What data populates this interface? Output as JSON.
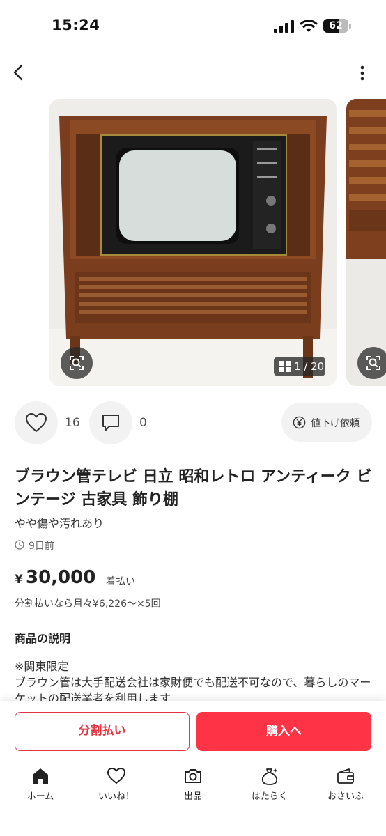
{
  "status_bar": {
    "time": "15:24",
    "battery": "62",
    "battery_fraction": 0.62
  },
  "carousel": {
    "counter": "1 / 20"
  },
  "actions": {
    "likes_count": "16",
    "comments_count": "0",
    "price_down_label": "値下げ依頼"
  },
  "item": {
    "title": "ブラウン管テレビ 日立 昭和レトロ アンティーク ビンテージ 古家具 飾り棚",
    "condition": "やや傷や汚れあり",
    "posted": "9日前",
    "price_symbol": "¥",
    "price": "30,000",
    "shipping": "着払い",
    "installment": "分割払いなら月々¥6,226〜×5回"
  },
  "description": {
    "heading": "商品の説明",
    "body": "※関東限定\nブラウン管は大手配送会社は家財便でも配送不可なので、暮らしのマーケットの配送業者を利用します"
  },
  "buttons": {
    "split_pay": "分割払い",
    "buy": "購入へ"
  },
  "tabs": [
    {
      "label": "ホーム",
      "icon": "home-icon"
    },
    {
      "label": "いいね！",
      "icon": "heart-icon"
    },
    {
      "label": "出品",
      "icon": "camera-icon"
    },
    {
      "label": "はたらく",
      "icon": "money-bag-icon"
    },
    {
      "label": "おさいふ",
      "icon": "wallet-icon"
    }
  ],
  "colors": {
    "accent": "#ff3346",
    "accent_outline": "#e33444"
  }
}
